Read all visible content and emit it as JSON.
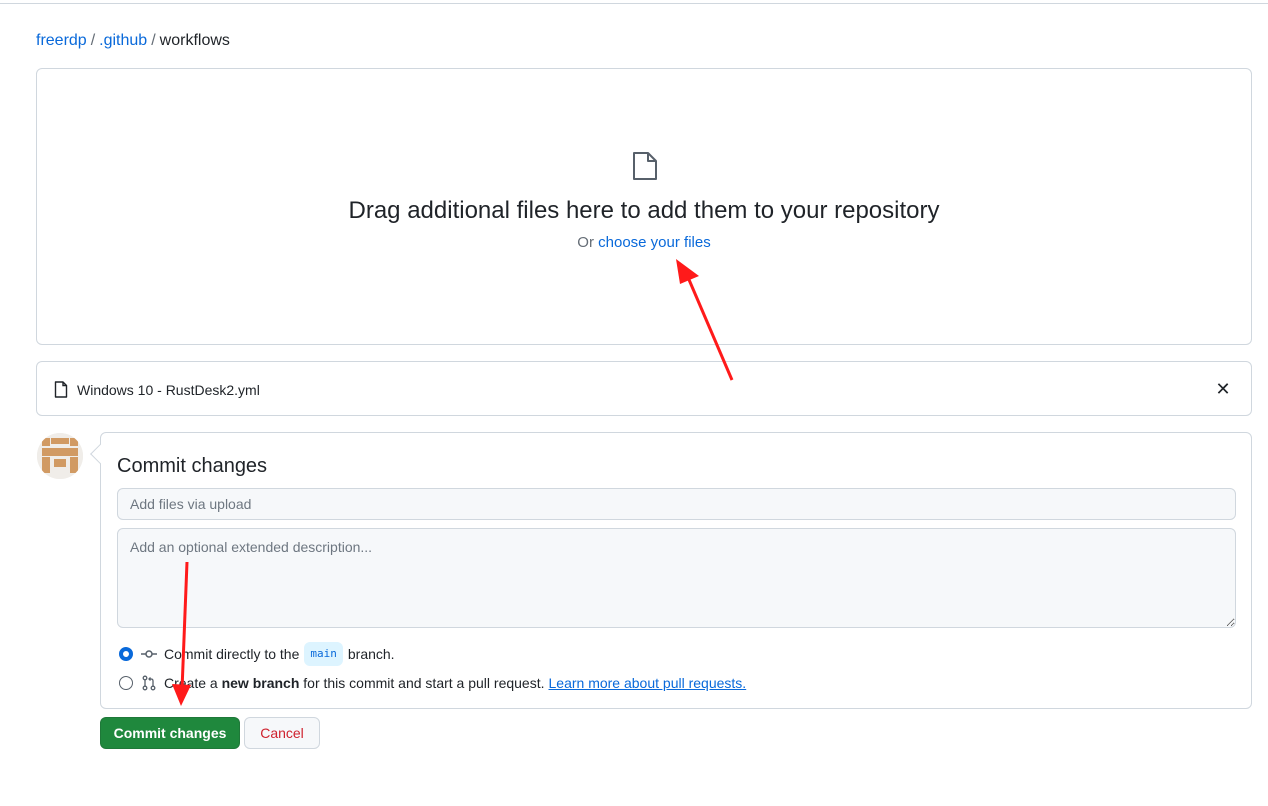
{
  "breadcrumb": {
    "owner": "freerdp",
    "folder": ".github",
    "current": "workflows",
    "separator": "/"
  },
  "dropzone": {
    "icon": "file-icon",
    "title": "Drag additional files here to add them to your repository",
    "or_text": "Or",
    "choose_link": "choose your files"
  },
  "upload": {
    "file_icon": "file-icon",
    "filename": "Windows 10 - RustDesk2.yml",
    "remove_icon": "close-icon",
    "remove_glyph": "✕"
  },
  "commit": {
    "heading": "Commit changes",
    "summary_placeholder": "Add files via upload",
    "description_placeholder": "Add an optional extended description...",
    "option_direct": {
      "selected": true,
      "icon": "git-commit-icon",
      "prefix": "Commit directly to the",
      "branch": "main",
      "suffix": "branch."
    },
    "option_new_branch": {
      "selected": false,
      "icon": "git-pull-request-icon",
      "prefix": "Create a",
      "bold": "new branch",
      "suffix": "for this commit and start a pull request.",
      "link": "Learn more about pull requests."
    },
    "submit_label": "Commit changes",
    "cancel_label": "Cancel"
  },
  "colors": {
    "link": "#0969da",
    "primary_button": "#1f883d",
    "danger_text": "#cf222e",
    "annotation_arrow": "#ff1a1a"
  }
}
